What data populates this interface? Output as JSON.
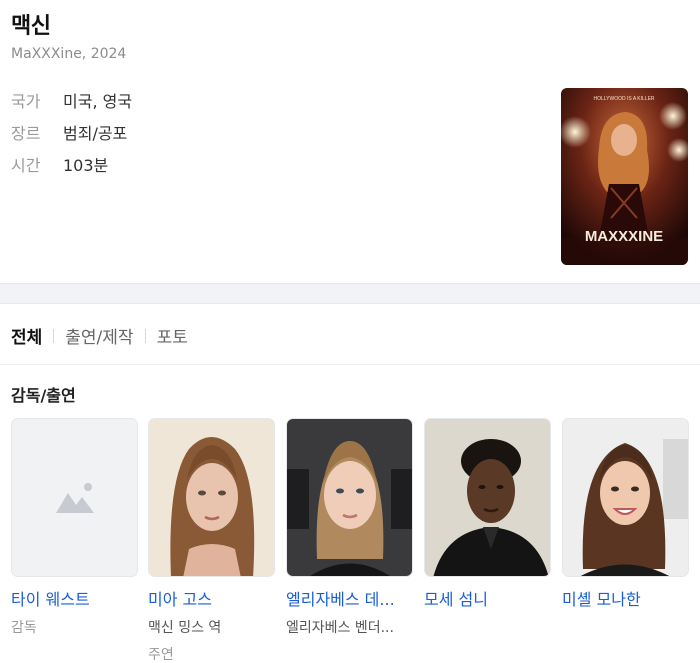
{
  "movie": {
    "title": "맥신",
    "subtitle": "MaXXXine, 2024",
    "info": [
      {
        "label": "국가",
        "value": "미국, 영국"
      },
      {
        "label": "장르",
        "value": "범죄/공포"
      },
      {
        "label": "시간",
        "value": "103분"
      }
    ],
    "poster": {
      "tagline": "HOLLYWOOD IS A KILLER",
      "title": "MAXXXINE"
    }
  },
  "tabs": [
    {
      "label": "전체"
    },
    {
      "label": "출연/제작"
    },
    {
      "label": "포토"
    }
  ],
  "section": {
    "title": "감독/출연"
  },
  "cast": [
    {
      "name": "타이 웨스트",
      "role": "감독",
      "sub": ""
    },
    {
      "name": "미아 고스",
      "role": "맥신 밍스 역",
      "sub": "주연"
    },
    {
      "name": "엘리자베스 데...",
      "role": "엘리자베스 벤더...",
      "sub": ""
    },
    {
      "name": "모세 섬니",
      "role": "",
      "sub": ""
    },
    {
      "name": "미셸 모나한",
      "role": "",
      "sub": ""
    }
  ],
  "colors": {
    "link": "#1a5fd6",
    "label": "#9a9a9a",
    "band": "#f2f3f6"
  }
}
